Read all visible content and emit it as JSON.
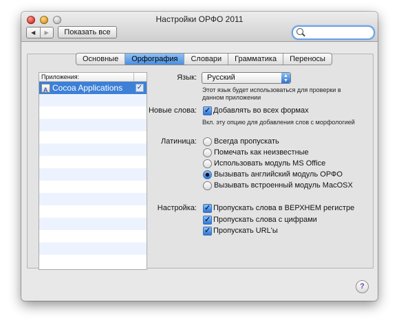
{
  "window": {
    "title": "Настройки ОРФО 2011"
  },
  "toolbar": {
    "back_icon": "◀",
    "forward_icon": "▶",
    "show_all_label": "Показать все",
    "search_value": ""
  },
  "tabs": [
    {
      "label": "Основные"
    },
    {
      "label": "Орфография"
    },
    {
      "label": "Словари"
    },
    {
      "label": "Грамматика"
    },
    {
      "label": "Переносы"
    }
  ],
  "apps": {
    "header": "Приложения:",
    "items": [
      {
        "name": "Cocoa Applications",
        "checked": true
      }
    ]
  },
  "language": {
    "label": "Язык:",
    "value": "Русский",
    "hint_line1": "Этот язык будет использоваться для проверки в",
    "hint_line2": "данном приложении"
  },
  "new_words": {
    "label": "Новые слова:",
    "option": "Добавлять во всех формах",
    "hint": "Вкл. эту опцию для добавления слов с морфологией"
  },
  "latin": {
    "label": "Латиница:",
    "options": [
      "Всегда пропускать",
      "Помечать как неизвестные",
      "Использовать модуль MS Office",
      "Вызывать английский модуль ОРФО",
      "Вызывать встроенный модуль MacOSX"
    ],
    "selected_index": 3
  },
  "settings": {
    "label": "Настройка:",
    "options": [
      "Пропускать слова в ВЕРХНЕМ регистре",
      "Пропускать слова с цифрами",
      "Пропускать URL'ы"
    ]
  },
  "help": {
    "label": "?"
  }
}
